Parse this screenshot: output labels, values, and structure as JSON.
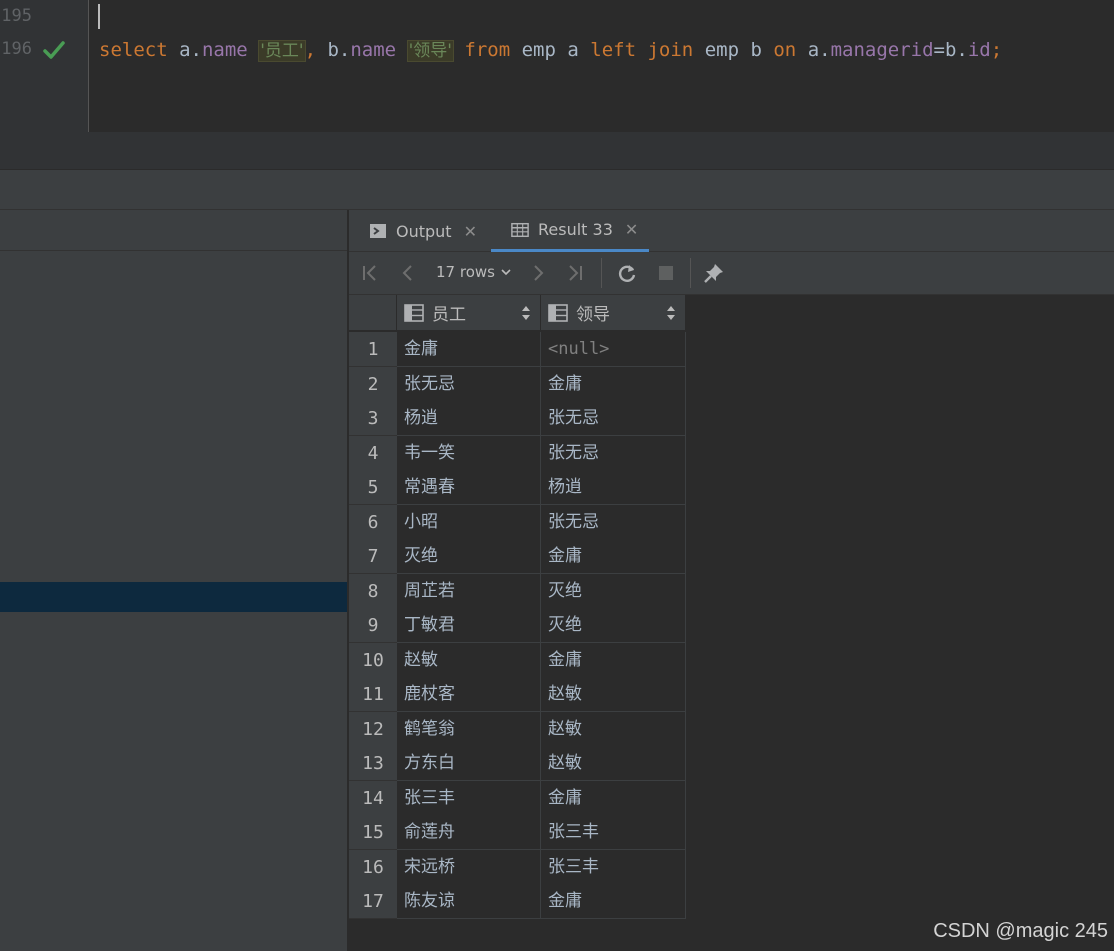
{
  "editor": {
    "line_numbers": [
      "195",
      "196"
    ],
    "code": {
      "kw_select": "select",
      "t1": "a.",
      "f1": "name",
      "s1": "'员工'",
      "comma": ", ",
      "t2": "b.",
      "f2": "name",
      "s2": "'领导'",
      "kw_from": "from",
      "tbl1": "emp a",
      "kw_left": "left",
      "kw_join": "join",
      "tbl2": "emp b",
      "kw_on": "on",
      "t3": "a.",
      "f3": "managerid",
      "eq": "=b.",
      "f4": "id",
      "semi": ";"
    }
  },
  "tabs": [
    {
      "label": "Output",
      "icon": "console-icon"
    },
    {
      "label": "Result 33",
      "icon": "table-icon"
    }
  ],
  "toolbar": {
    "rows_label": "17 rows"
  },
  "grid": {
    "columns": [
      "员工",
      "领导"
    ],
    "rows": [
      {
        "n": "1",
        "c1": "金庸",
        "c2": "<null>"
      },
      {
        "n": "2",
        "c1": "张无忌",
        "c2": "金庸"
      },
      {
        "n": "3",
        "c1": "杨逍",
        "c2": "张无忌"
      },
      {
        "n": "4",
        "c1": "韦一笑",
        "c2": "张无忌"
      },
      {
        "n": "5",
        "c1": "常遇春",
        "c2": "杨逍"
      },
      {
        "n": "6",
        "c1": "小昭",
        "c2": "张无忌"
      },
      {
        "n": "7",
        "c1": "灭绝",
        "c2": "金庸"
      },
      {
        "n": "8",
        "c1": "周芷若",
        "c2": "灭绝"
      },
      {
        "n": "9",
        "c1": "丁敏君",
        "c2": "灭绝"
      },
      {
        "n": "10",
        "c1": "赵敏",
        "c2": "金庸"
      },
      {
        "n": "11",
        "c1": "鹿杖客",
        "c2": "赵敏"
      },
      {
        "n": "12",
        "c1": "鹤笔翁",
        "c2": "赵敏"
      },
      {
        "n": "13",
        "c1": "方东白",
        "c2": "赵敏"
      },
      {
        "n": "14",
        "c1": "张三丰",
        "c2": "金庸"
      },
      {
        "n": "15",
        "c1": "俞莲舟",
        "c2": "张三丰"
      },
      {
        "n": "16",
        "c1": "宋远桥",
        "c2": "张三丰"
      },
      {
        "n": "17",
        "c1": "陈友谅",
        "c2": "金庸"
      }
    ]
  },
  "watermark": "CSDN @magic 245",
  "colors": {
    "keyword": "#cc7832",
    "field": "#9876aa",
    "string": "#6a8759",
    "success": "#499c54",
    "accent": "#4a88c7"
  }
}
